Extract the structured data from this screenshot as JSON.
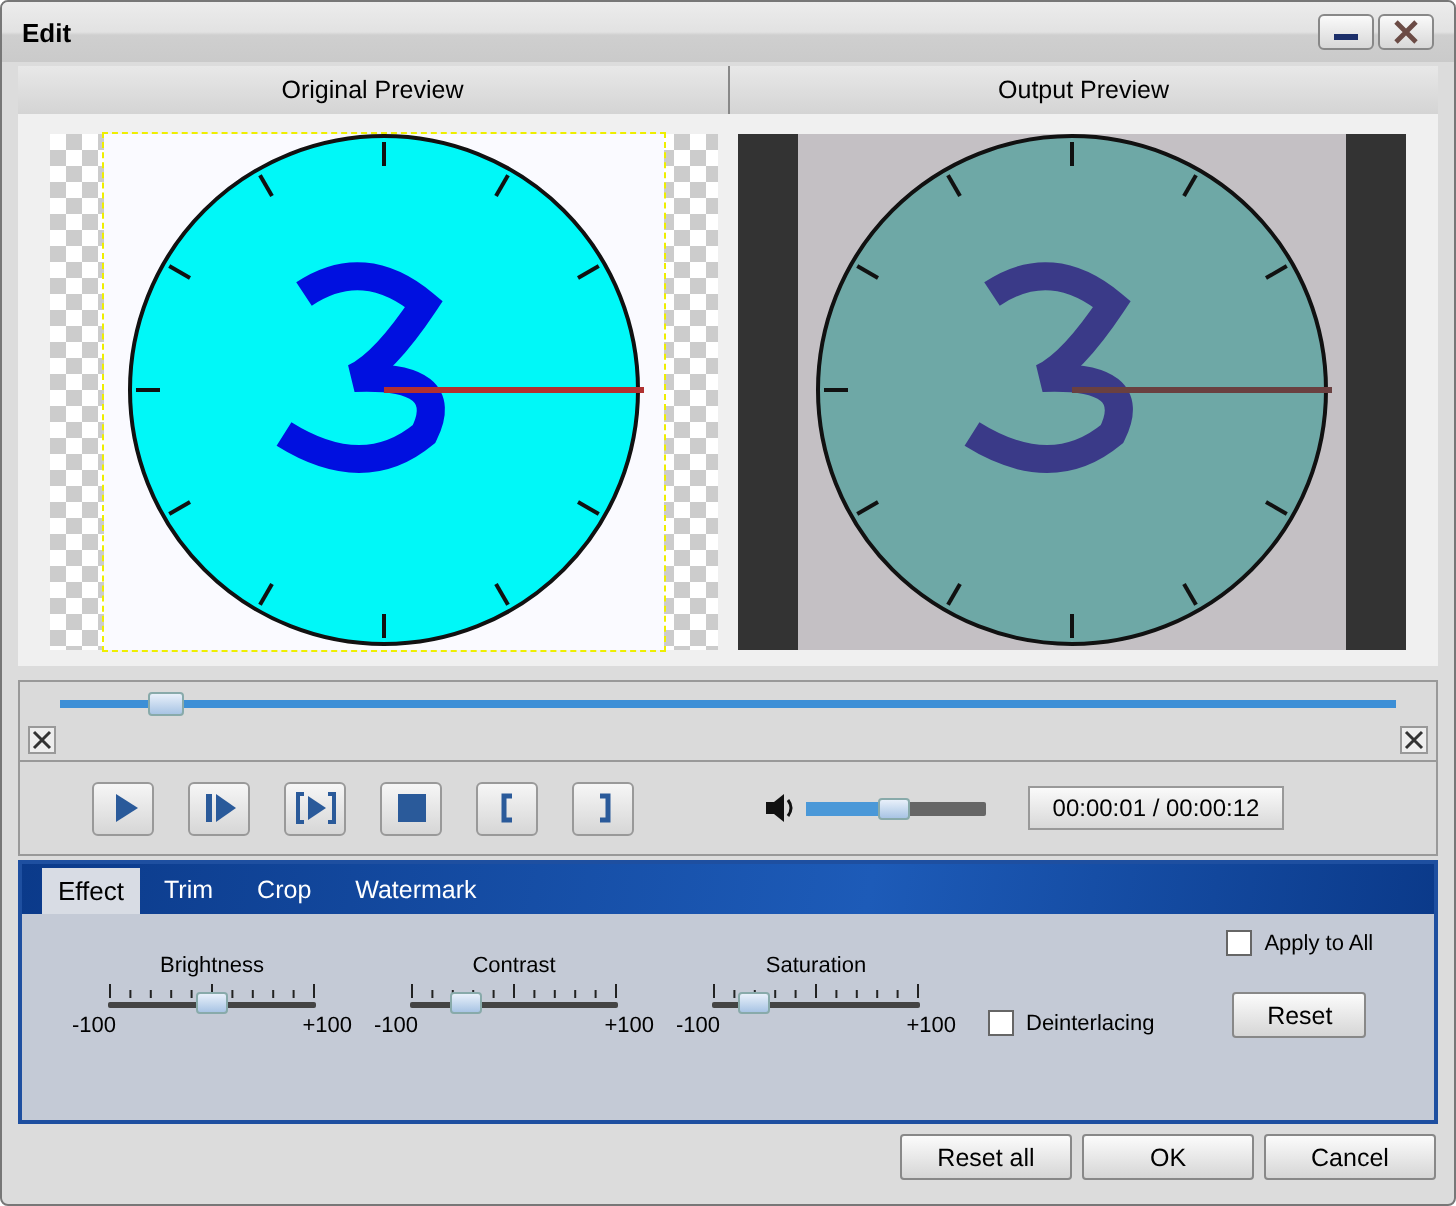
{
  "window": {
    "title": "Edit"
  },
  "previews": [
    {
      "label": "Original Preview",
      "kind": "original"
    },
    {
      "label": "Output Preview",
      "kind": "output"
    }
  ],
  "seek": {
    "level": 0.08
  },
  "player_buttons": [
    {
      "kind": "play"
    },
    {
      "kind": "step"
    },
    {
      "kind": "play-range"
    },
    {
      "kind": "stop"
    },
    {
      "kind": "mark-in"
    },
    {
      "kind": "mark-out"
    }
  ],
  "volume": {
    "level": 0.49
  },
  "time": "00:00:01 / 00:00:12",
  "tabs": [
    {
      "label": "Effect",
      "selected": true
    },
    {
      "label": "Trim",
      "selected": false
    },
    {
      "label": "Crop",
      "selected": false
    },
    {
      "label": "Watermark",
      "selected": false
    }
  ],
  "sliders": [
    {
      "label": "Brightness",
      "level": 0.5,
      "min": "-100",
      "max": "+100"
    },
    {
      "label": "Contrast",
      "level": 0.27,
      "min": "-100",
      "max": "+100"
    },
    {
      "label": "Saturation",
      "level": 0.2,
      "min": "-100",
      "max": "+100"
    }
  ],
  "deinterlacing": {
    "label": "Deinterlacing",
    "checked": false
  },
  "apply_to_all": {
    "label": "Apply to All",
    "checked": false
  },
  "reset": "Reset",
  "buttons": [
    "Reset all",
    "OK",
    "Cancel"
  ]
}
